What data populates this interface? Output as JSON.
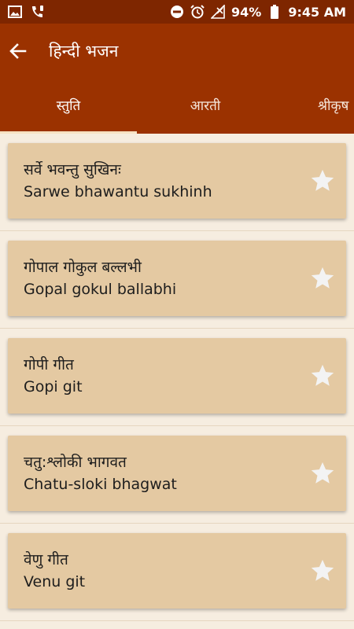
{
  "status_bar": {
    "battery": "94%",
    "time": "9:45 AM"
  },
  "app_bar": {
    "title": "हिन्दी भजन"
  },
  "tabs": [
    {
      "label": "स्तुति"
    },
    {
      "label": "आरती"
    },
    {
      "label": "श्रीकृष"
    }
  ],
  "items": [
    {
      "hindi": "सर्वे भवन्तु सुखिनः",
      "latin": "Sarwe bhawantu sukhinh"
    },
    {
      "hindi": "गोपाल गोकुल बल्लभी",
      "latin": "Gopal gokul ballabhi"
    },
    {
      "hindi": "गोपी गीत",
      "latin": "Gopi git"
    },
    {
      "hindi": "चतु:श्लोकी भागवत",
      "latin": "Chatu-sloki bhagwat"
    },
    {
      "hindi": "वेणु गीत",
      "latin": "Venu git"
    }
  ],
  "colors": {
    "status_bar": "#7e2600",
    "app_bar": "#9b3200",
    "background": "#f6ede0",
    "card": "#e4c9a2",
    "star": "#f3f3f3"
  }
}
